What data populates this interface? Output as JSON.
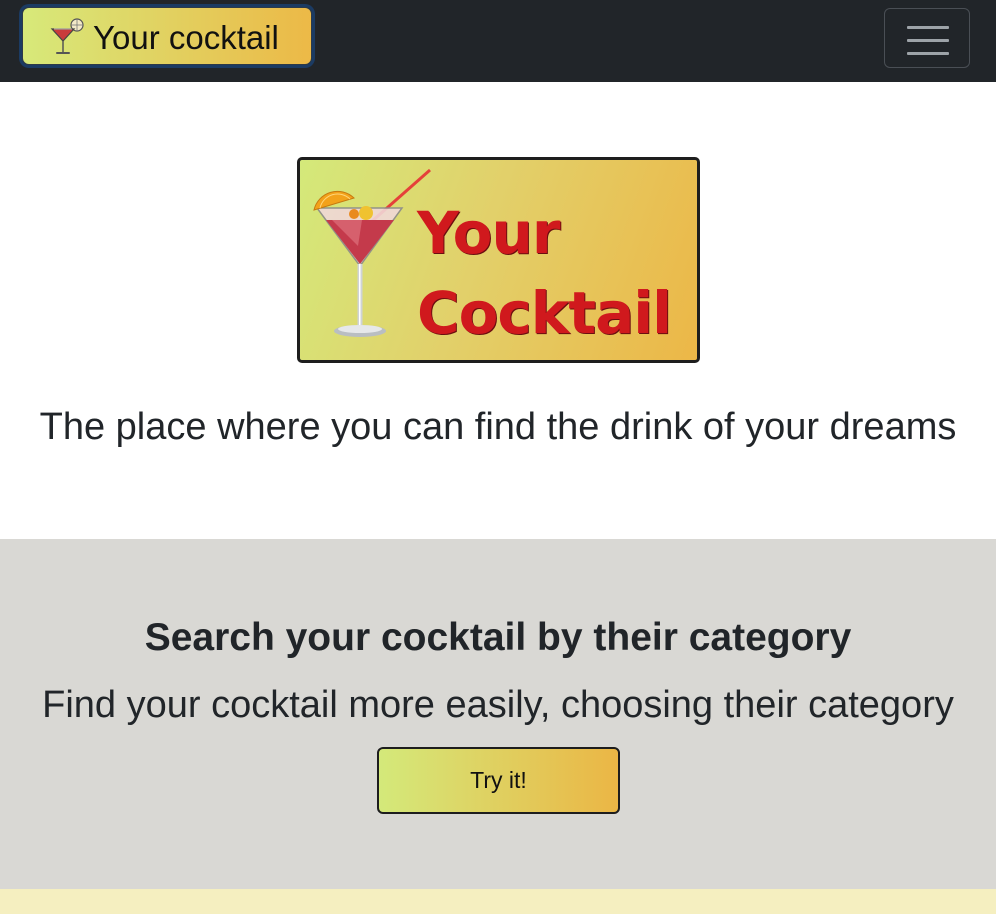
{
  "navbar": {
    "brand_label": "Your cocktail",
    "brand_icon": "cocktail-glass-icon",
    "toggler_icon": "hamburger-menu-icon",
    "background": "#212529"
  },
  "hero": {
    "logo": {
      "line1": "Your",
      "line2": "Cocktail",
      "icon": "cocktail-glass-icon",
      "text_color": "#d0191d"
    },
    "tagline": "The place where you can find the drink of your dreams"
  },
  "category_section": {
    "title": "Search your cocktail by their category",
    "subtitle": "Find your cocktail more easily, choosing their category",
    "button_label": "Try it!",
    "background": "#d9d8d4"
  },
  "theme": {
    "gradient_start": "#d4e97a",
    "gradient_end": "#ebb645",
    "footer_strip": "#f5efc0"
  }
}
